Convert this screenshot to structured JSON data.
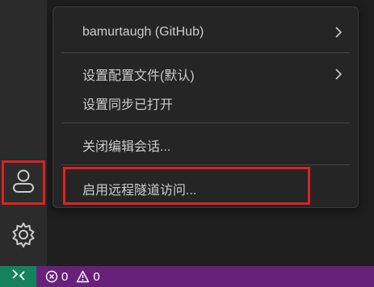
{
  "menu": {
    "account_label": "bamurtaugh (GitHub)",
    "settings_profile_label": "设置配置文件(默认)",
    "settings_sync_label": "设置同步已打开",
    "close_session_label": "关闭编辑会话...",
    "remote_tunnel_label": "启用远程隧道访问..."
  },
  "status_bar": {
    "errors_count": "0",
    "warnings_count": "0"
  },
  "colors": {
    "status_bar_bg": "#68217a",
    "remote_button_bg": "#16825d",
    "highlight": "#e02020"
  },
  "icons": {
    "accounts": "account-icon",
    "manage": "gear-icon",
    "remote": "remote-icon",
    "error": "error-icon",
    "warning": "warning-icon",
    "submenu": "chevron-right-icon"
  }
}
